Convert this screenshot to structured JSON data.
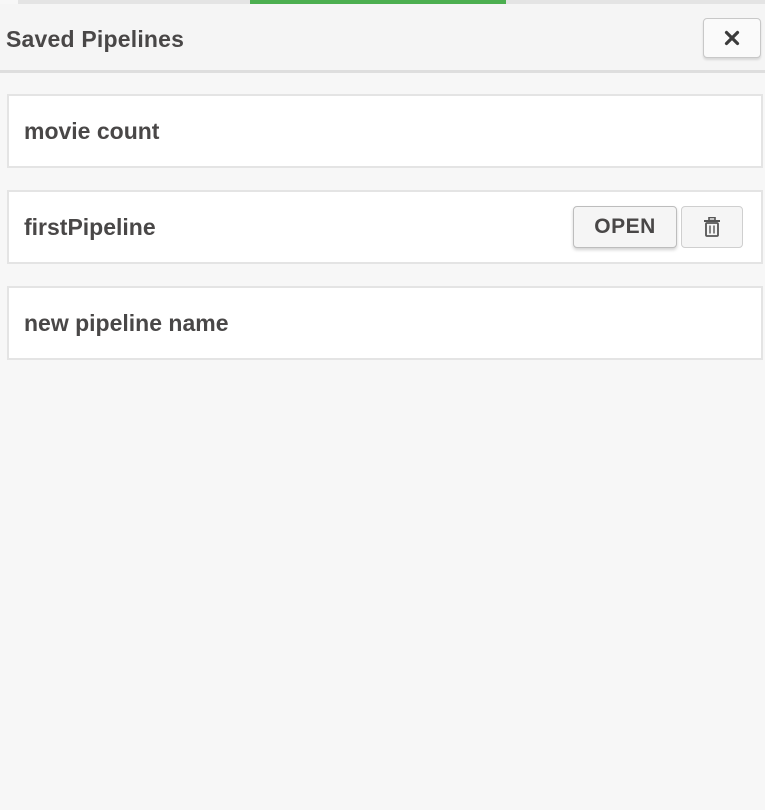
{
  "header": {
    "title": "Saved Pipelines",
    "close_icon": "close-x-icon"
  },
  "pipelines": [
    {
      "name": "movie count"
    },
    {
      "name": "firstPipeline",
      "open_label": "OPEN",
      "delete_icon": "trash-icon"
    },
    {
      "name": "new pipeline name"
    }
  ],
  "colors": {
    "accent": "#4caf50",
    "background": "#f7f7f7",
    "text": "#494747"
  }
}
